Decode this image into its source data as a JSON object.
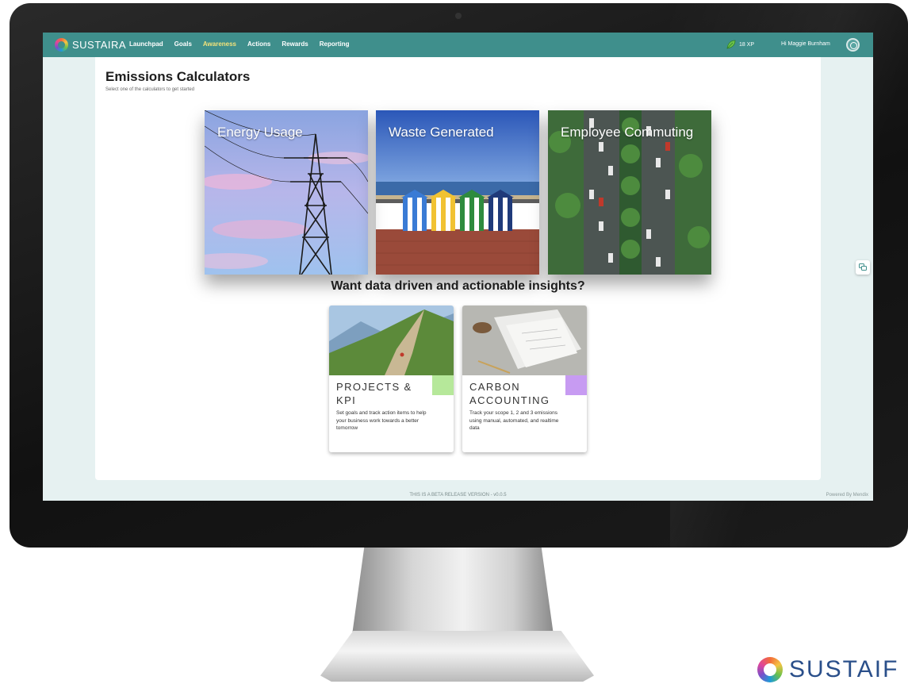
{
  "app": {
    "logo_text": "SUSTAIRA"
  },
  "nav": {
    "items": [
      {
        "label": "Launchpad",
        "active": false
      },
      {
        "label": "Goals",
        "active": false
      },
      {
        "label": "Awareness",
        "active": true
      },
      {
        "label": "Actions",
        "active": false
      },
      {
        "label": "Rewards",
        "active": false
      },
      {
        "label": "Reporting",
        "active": false
      }
    ]
  },
  "user": {
    "xp": "18 XP",
    "greeting": "Hi Maggie Burnham"
  },
  "page": {
    "title": "Emissions Calculators",
    "subtitle": "Select one of the calculators to get started"
  },
  "calculators": [
    {
      "label": "Energy Usage"
    },
    {
      "label": "Waste Generated"
    },
    {
      "label": "Employee Commuting"
    }
  ],
  "cta": "Want data driven and actionable insights?",
  "cards": [
    {
      "title": "PROJECTS & KPI",
      "description": "Set goals and track action items to help your business work towards a better tomorrow",
      "accent": "#b6e89a"
    },
    {
      "title": "CARBON ACCOUNTING",
      "description": "Track your scope 1, 2 and 3 emissions using manual, automated, and realtime data",
      "accent": "#c79bf2"
    }
  ],
  "footer": {
    "beta": "THIS IS A BETA RELEASE VERSION - v0.0.5",
    "powered": "Powered By Mendix"
  },
  "brand_mark": {
    "text": "SUSTAIF"
  },
  "colors": {
    "topbar": "#3f8f8c",
    "active_nav": "#f3e37a"
  }
}
